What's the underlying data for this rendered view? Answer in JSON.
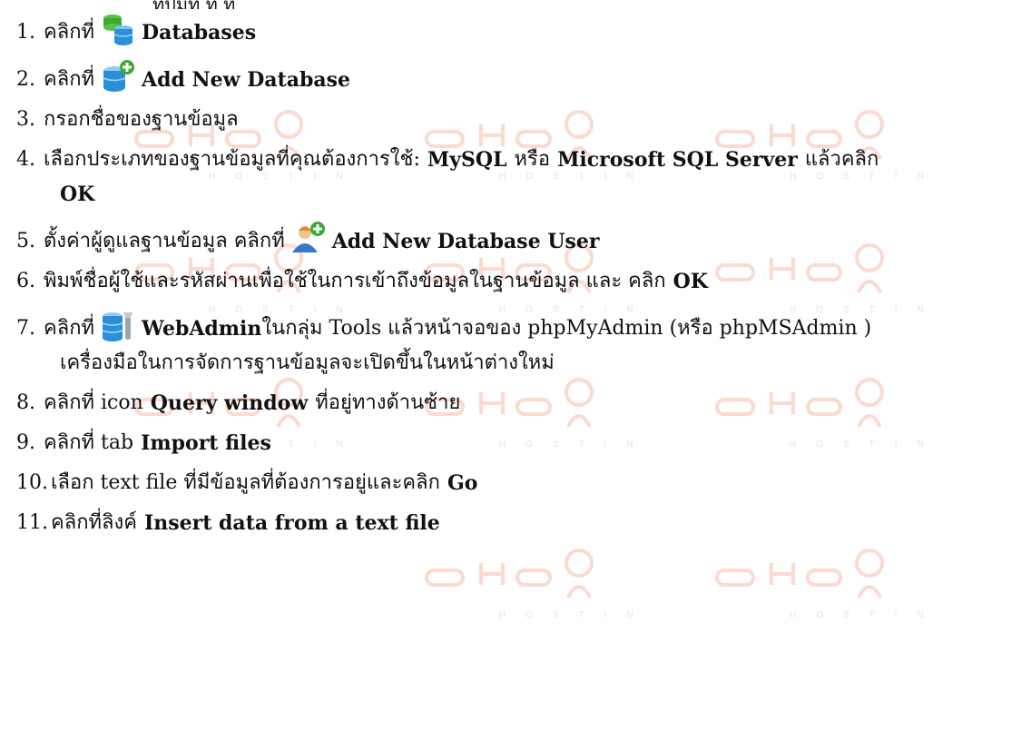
{
  "top_cut_text": "ที่ปุ่มที่ ที่ ที่",
  "steps": [
    {
      "num": "1.",
      "pre": "คลิกที่",
      "bold": "Databases"
    },
    {
      "num": "2.",
      "pre": "คลิกที่",
      "bold": "Add New Database"
    },
    {
      "num": "3.",
      "text": "กรอกชื่อของฐานข้อมูล"
    },
    {
      "num": "4.",
      "pre": "เลือกประเภทของฐานข้อมูลที่คุณต้องการใช้:",
      "b1": "MySQL",
      "mid": "หรือ",
      "b2": "Microsoft SQL Server",
      "post": "แล้วคลิก",
      "wrap_bold": "OK"
    },
    {
      "num": "5.",
      "pre": "ตั้งค่าผู้ดูแลฐานข้อมูล คลิกที่",
      "bold": "Add New Database User"
    },
    {
      "num": "6.",
      "pre": "พิมพ์ชื่อผู้ใช้และรหัสผ่านเพื่อใช้ในการเข้าถึงข้อมูลในฐานข้อมูล และ คลิก",
      "bold": "OK"
    },
    {
      "num": "7.",
      "pre": "คลิกที่",
      "bold": "WebAdmin",
      "post": "ในกลุ่ม Tools แล้วหน้าจอของ phpMyAdmin (หรือ phpMSAdmin )",
      "wrap": "เครื่องมือในการจัดการฐานข้อมูลจะเปิดขึ้นในหน้าต่างใหม่"
    },
    {
      "num": "8.",
      "pre": "คลิกที่ icon",
      "bold": "Query window",
      "post": "ที่อยู่ทางด้านซ้าย"
    },
    {
      "num": "9.",
      "pre": "คลิกที่ tab",
      "bold": "Import files"
    },
    {
      "num": "10.",
      "pre": "เลือก text file ที่มีข้อมูลที่ต้องการอยู่และคลิก",
      "bold": "Go"
    },
    {
      "num": "11.",
      "pre": "คลิกที่ลิงค์",
      "bold": "Insert data from a text file"
    }
  ],
  "watermark": {
    "word": "chai",
    "sub": "HOSTING",
    "color": "#f05a28"
  },
  "icons": [
    "database-stack-icon",
    "database-add-icon",
    "user-add-icon",
    "database-admin-tools-icon"
  ]
}
